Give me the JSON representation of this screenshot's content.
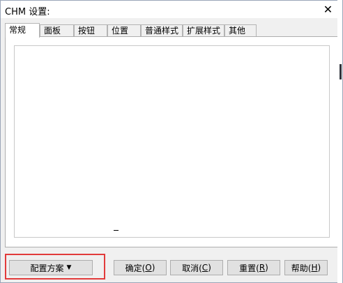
{
  "window": {
    "title": "CHM 设置:",
    "close_glyph": "✕"
  },
  "tabs": [
    {
      "label": "常规",
      "active": true
    },
    {
      "label": "面板",
      "active": false
    },
    {
      "label": "按钮",
      "active": false
    },
    {
      "label": "位置",
      "active": false
    },
    {
      "label": "普通样式",
      "active": false
    },
    {
      "label": "扩展样式",
      "active": false
    },
    {
      "label": "其他",
      "active": false
    }
  ],
  "buttons": {
    "scheme": {
      "label": "配置方案",
      "arrow": "▼"
    },
    "ok": {
      "label": "确定(",
      "key": "O",
      "close": ")"
    },
    "cancel": {
      "label": "取消(",
      "key": "C",
      "close": ")"
    },
    "reset": {
      "label": "重置(",
      "key": "R",
      "close": ")"
    },
    "help": {
      "label": "帮助(",
      "key": "H",
      "close": ")"
    }
  },
  "icons": {
    "close": "close-icon",
    "dropdown": "chevron-down-icon"
  },
  "colors": {
    "highlight": "#e23b3b",
    "window_border": "#9aa5b8",
    "dialog_background": "#f0f0f0"
  }
}
